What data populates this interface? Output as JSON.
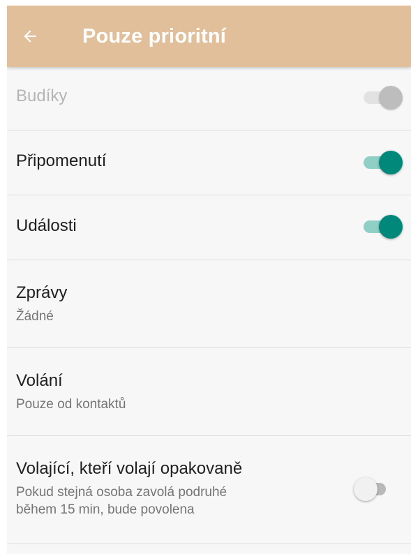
{
  "app_bar": {
    "title": "Pouze prioritní",
    "background_color": "#e0bf9a",
    "back_icon": "arrow-back-icon"
  },
  "settings": [
    {
      "title": "Budíky",
      "subtitle": "",
      "control": "switch",
      "checked": true,
      "enabled": false
    },
    {
      "title": "Připomenutí",
      "subtitle": "",
      "control": "switch",
      "checked": true,
      "enabled": true
    },
    {
      "title": "Události",
      "subtitle": "",
      "control": "switch",
      "checked": true,
      "enabled": true
    },
    {
      "title": "Zprávy",
      "subtitle": "Žádné",
      "control": "none"
    },
    {
      "title": "Volání",
      "subtitle": "Pouze od kontaktů",
      "control": "none"
    },
    {
      "title": "Volající, kteří volají opakovaně",
      "subtitle_lines": [
        "Pokud stejná osoba zavolá podruhé",
        "během 15 min, bude povolena"
      ],
      "control": "switch",
      "checked": false,
      "enabled": true
    }
  ],
  "colors": {
    "accent": "#00897b",
    "accent_track": "#8fcfc6"
  }
}
